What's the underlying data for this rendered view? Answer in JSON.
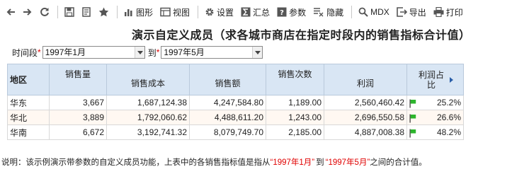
{
  "toolbar": {
    "items": [
      {
        "icon": "arrow-left-icon",
        "label": ""
      },
      {
        "icon": "arrow-right-icon",
        "label": ""
      },
      {
        "icon": "refresh-icon",
        "label": ""
      },
      {
        "icon": "save-icon",
        "label": ""
      },
      {
        "icon": "save-as-icon",
        "label": ""
      },
      {
        "icon": "favorite-star-icon",
        "label": ""
      },
      {
        "icon": "chart-icon",
        "label": "图形"
      },
      {
        "icon": "view-icon",
        "label": "视图"
      },
      {
        "icon": "gear-icon",
        "label": "设置"
      },
      {
        "icon": "sum-icon",
        "label": "汇总"
      },
      {
        "icon": "question-icon",
        "label": "参数"
      },
      {
        "icon": "hide-icon",
        "label": "隐藏"
      },
      {
        "icon": "search-icon",
        "label": "MDX"
      },
      {
        "icon": "export-icon",
        "label": "导出"
      },
      {
        "icon": "print-icon",
        "label": "打印"
      }
    ]
  },
  "title": "演示自定义成员（求各城市商店在指定时段内的销售指标合计值）",
  "filter": {
    "label": "时间段",
    "required_mark": "*",
    "from_value": "1997年1月",
    "to_label": "到",
    "to_required_mark": "*",
    "to_value": "1997年5月"
  },
  "table": {
    "headers": [
      "地区",
      "销售量",
      "销售成本",
      "销售额",
      "销售次数",
      "利润",
      "利润占比"
    ],
    "rows": [
      {
        "region": "华东",
        "qty": "3,667",
        "cost": "1,687,124.38",
        "sales": "4,247,584.80",
        "count": "1,189.00",
        "profit": "2,560,460.42",
        "pct": "25.2%"
      },
      {
        "region": "华北",
        "qty": "3,889",
        "cost": "1,792,060.62",
        "sales": "4,488,611.20",
        "count": "1,243.00",
        "profit": "2,696,550.58",
        "pct": "26.6%"
      },
      {
        "region": "华南",
        "qty": "6,672",
        "cost": "3,192,741.32",
        "sales": "8,079,749.70",
        "count": "2,185.00",
        "profit": "4,887,008.38",
        "pct": "48.2%"
      }
    ],
    "flag_color": "#2db52d"
  },
  "note": {
    "prefix": "说明：该示例演示带参数的自定义成员功能，上表中的各销售指标值是指从",
    "from": "“1997年1月”",
    "mid": "到",
    "to": "“1997年5月”",
    "suffix": "之间的合计值。"
  }
}
